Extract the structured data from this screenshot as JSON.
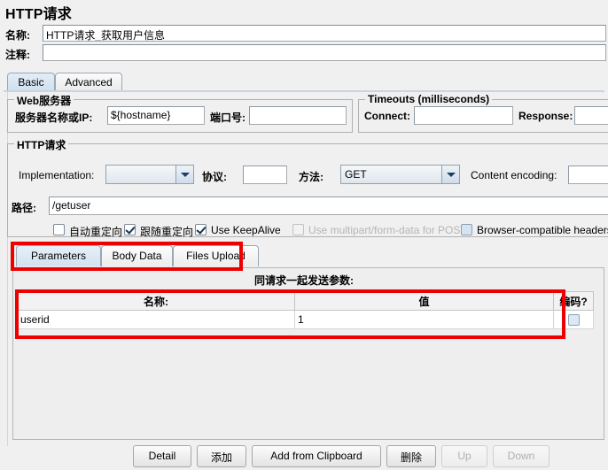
{
  "window": {
    "title": "HTTP请求"
  },
  "header": {
    "name_label": "名称:",
    "name_value": "HTTP请求_获取用户信息",
    "comment_label": "注释:",
    "comment_value": ""
  },
  "main_tabs": [
    {
      "label": "Basic",
      "selected": true
    },
    {
      "label": "Advanced",
      "selected": false
    }
  ],
  "web_server": {
    "legend": "Web服务器",
    "server_label": "服务器名称或IP:",
    "server_value": "${hostname}",
    "port_label": "端口号:",
    "port_value": ""
  },
  "timeouts": {
    "legend": "Timeouts (milliseconds)",
    "connect_label": "Connect:",
    "connect_value": "",
    "response_label": "Response:",
    "response_value": ""
  },
  "http_request": {
    "legend": "HTTP请求",
    "implementation_label": "Implementation:",
    "implementation_value": "",
    "protocol_label": "协议:",
    "protocol_value": "",
    "method_label": "方法:",
    "method_value": "GET",
    "content_encoding_label": "Content encoding:",
    "content_encoding_value": "",
    "path_label": "路径:",
    "path_value": "/getuser"
  },
  "checkboxes": [
    {
      "label": "自动重定向",
      "checked": false,
      "disabled": false
    },
    {
      "label": "跟随重定向",
      "checked": true,
      "disabled": false
    },
    {
      "label": "Use KeepAlive",
      "checked": true,
      "disabled": false
    },
    {
      "label": "Use multipart/form-data for POST",
      "checked": false,
      "disabled": true
    },
    {
      "label": "Browser-compatible headers",
      "checked": false,
      "disabled": false
    }
  ],
  "sub_tabs": [
    {
      "label": "Parameters",
      "selected": true
    },
    {
      "label": "Body Data",
      "selected": false
    },
    {
      "label": "Files Upload",
      "selected": false
    }
  ],
  "parameters": {
    "caption": "同请求一起发送参数:",
    "columns": [
      "名称:",
      "值",
      "编码?"
    ],
    "rows": [
      {
        "name": "userid",
        "value": "1",
        "encode": false
      }
    ]
  },
  "buttons": [
    {
      "label": "Detail",
      "disabled": false
    },
    {
      "label": "添加",
      "disabled": false
    },
    {
      "label": "Add from Clipboard",
      "disabled": false
    },
    {
      "label": "删除",
      "disabled": false
    },
    {
      "label": "Up",
      "disabled": true
    },
    {
      "label": "Down",
      "disabled": true
    }
  ],
  "annotations": {
    "accent_color": "#ee0000"
  }
}
